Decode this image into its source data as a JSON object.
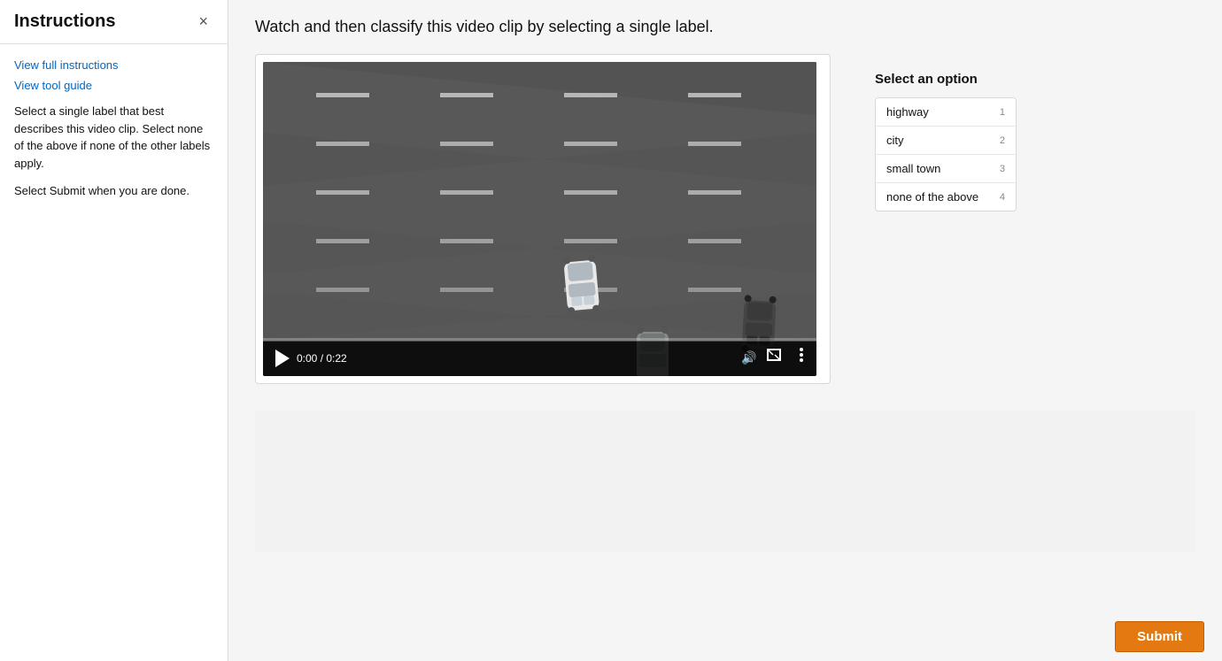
{
  "sidebar": {
    "title": "Instructions",
    "close_label": "×",
    "links": [
      {
        "id": "full-instructions",
        "label": "View full instructions"
      },
      {
        "id": "tool-guide",
        "label": "View tool guide"
      }
    ],
    "paragraphs": [
      "Select a single label that best describes this video clip. Select none of the above if none of the other labels apply.",
      "Select Submit when you are done."
    ]
  },
  "task": {
    "instruction": "Watch and then classify this video clip by selecting a single label."
  },
  "video": {
    "time_current": "0:00",
    "time_total": "0:22",
    "progress_percent": 0
  },
  "options_panel": {
    "heading": "Select an option",
    "options": [
      {
        "label": "highway",
        "number": "1"
      },
      {
        "label": "city",
        "number": "2"
      },
      {
        "label": "small town",
        "number": "3"
      },
      {
        "label": "none of the above",
        "number": "4"
      }
    ]
  },
  "submit": {
    "label": "Submit"
  },
  "icons": {
    "play": "▶",
    "volume": "🔊",
    "fullscreen": "⛶",
    "more": "⋮"
  }
}
